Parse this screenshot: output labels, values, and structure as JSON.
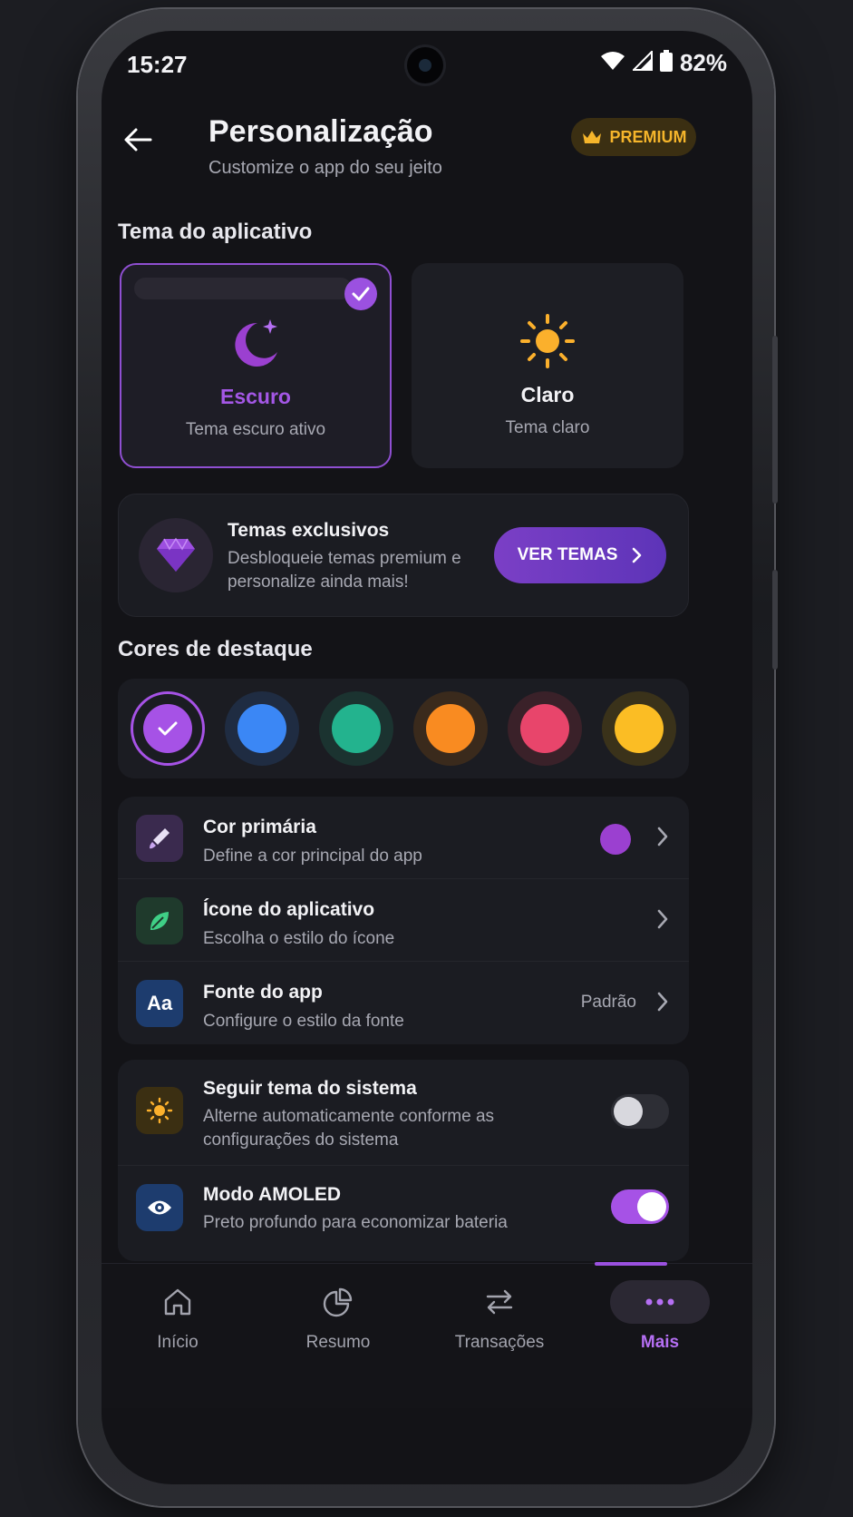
{
  "status_bar": {
    "time": "15:27",
    "battery": "82%"
  },
  "header": {
    "title": "Personalização",
    "subtitle": "Customize o app do seu jeito",
    "badge": "PREMIUM"
  },
  "theme_section": {
    "title": "Tema do aplicativo",
    "options": [
      {
        "name": "Escuro",
        "desc": "Tema escuro ativo",
        "selected": true,
        "icon": "moon-icon"
      },
      {
        "name": "Claro",
        "desc": "Tema claro",
        "selected": false,
        "icon": "sun-icon"
      }
    ]
  },
  "promo": {
    "title": "Temas exclusivos",
    "desc": "Desbloqueie temas premium e personalize ainda mais!",
    "button": "VER TEMAS"
  },
  "accent_section": {
    "title": "Cores de destaque",
    "colors": [
      "#a652e6",
      "#3b87f5",
      "#23b38e",
      "#f98b21",
      "#e8456b",
      "#fbbd24"
    ],
    "selected_index": 0
  },
  "settings": [
    {
      "title": "Cor primária",
      "sub": "Define a cor principal do app",
      "icon": "brush-icon",
      "color": "#9b40d0"
    },
    {
      "title": "Ícone do aplicativo",
      "sub": "Escolha o estilo do ícone",
      "icon": "leaf-icon"
    },
    {
      "title": "Fonte do app",
      "sub": "Configure o estilo da fonte",
      "value": "Padrão",
      "icon": "font-icon",
      "icon_text": "Aa"
    }
  ],
  "toggles": [
    {
      "title": "Seguir tema do sistema",
      "sub": "Alterne automaticamente conforme as configurações do sistema",
      "on": false,
      "icon": "sun-icon"
    },
    {
      "title": "Modo AMOLED",
      "sub": "Preto profundo para economizar bateria",
      "on": true,
      "icon": "eye-icon"
    }
  ],
  "nav": [
    {
      "label": "Início",
      "icon": "home-icon"
    },
    {
      "label": "Resumo",
      "icon": "pie-chart-icon"
    },
    {
      "label": "Transações",
      "icon": "transfer-icon"
    },
    {
      "label": "Mais",
      "icon": "more-icon",
      "active": true
    }
  ]
}
